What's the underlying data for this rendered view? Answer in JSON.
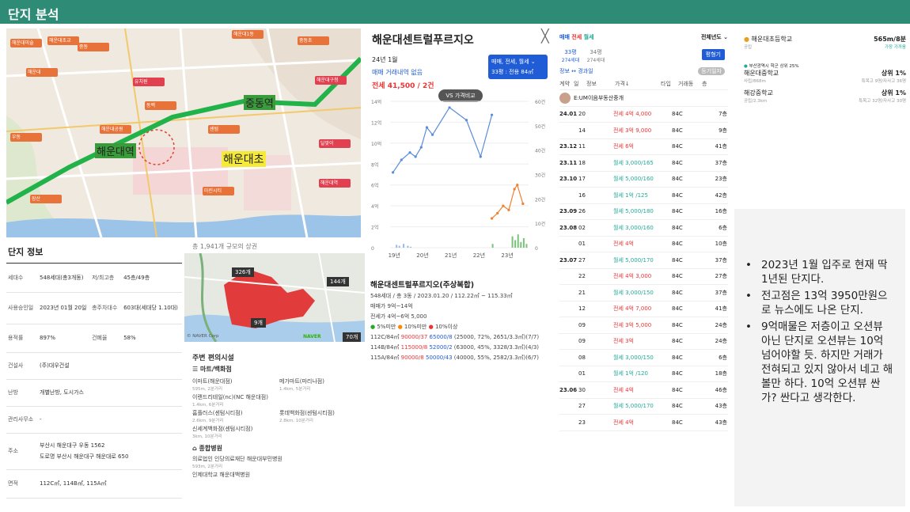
{
  "header": {
    "title": "단지 분석"
  },
  "map1": {
    "station_labels": [
      "중동역",
      "해운대역"
    ],
    "beach_label": "해운대초",
    "poi_labels": [
      "해운대미술",
      "해운대초교",
      "중동",
      "해운대",
      "유치원",
      "해운대1동",
      "중동초",
      "해운대구청",
      "동백",
      "센텀",
      "우동",
      "해운대공원",
      "달맞이",
      "마린시티",
      "장산",
      "해운대역"
    ]
  },
  "info": {
    "title": "단지 정보",
    "rows": [
      {
        "k1": "세대수",
        "v1": "548세대(총3개동)",
        "k2": "저/최고층",
        "v2": "45층/49층"
      },
      {
        "k1": "사용승인일",
        "v1": "2023년 01월 20일",
        "k2": "총주차대수",
        "v2": "603대(세대당 1.10대)"
      },
      {
        "k1": "용적률",
        "v1": "897%",
        "k2": "건폐율",
        "v2": "58%"
      },
      {
        "k1": "건설사",
        "v1": "(주)대우건설",
        "k2": "",
        "v2": ""
      },
      {
        "k1": "난방",
        "v1": "개별난방, 도시가스",
        "k2": "",
        "v2": ""
      },
      {
        "k1": "관리사무소",
        "v1": "-",
        "k2": "",
        "v2": ""
      },
      {
        "k1": "주소",
        "v1": "부산시 해운대구 우동 1562",
        "v1b": "도로명 부산시 해운대구 해운대로 650",
        "k2": "",
        "v2": ""
      },
      {
        "k1": "면적",
        "v1": "112C㎡, 114B㎡, 115A㎡",
        "k2": "",
        "v2": ""
      }
    ]
  },
  "map2": {
    "caption": "총 1,941개 규모의 상권",
    "labels": [
      "326개",
      "144개",
      "70개",
      "9개"
    ],
    "corner": "© NAVER Corp",
    "brand": "NAVER"
  },
  "facilities": {
    "title": "주변 편의시설",
    "mart_title": "마트/백화점",
    "marts": [
      {
        "name": "이마트(해운대점)",
        "dist": "595m, 2분거리"
      },
      {
        "name": "메가마트(마리나점)",
        "dist": "1.4km, 5분거리"
      },
      {
        "name": "이랜드리테일(nc)(NC 해운대점)",
        "dist": "1.4km, 6분거리"
      },
      {
        "name": "홈플러스(센텀시티점)",
        "dist": "2.6km, 9분거리"
      },
      {
        "name": "롯데백화점(센텀시티점)",
        "dist": "2.8km, 10분거리"
      },
      {
        "name": "신세계백화점(센텀시티점)",
        "dist": "3km, 10분거리"
      }
    ],
    "hospital_title": "종합병원",
    "hospitals": [
      {
        "name": "의료법인 인당의료재단 해운대부민병원",
        "dist": "593m, 2분거리"
      },
      {
        "name": "인제대학교 해운대백병원",
        "dist": ""
      }
    ]
  },
  "complex": {
    "name": "해운대센트럴푸르지오",
    "date": "24년 1월",
    "no_trade": "매매 거래내역 없음",
    "price": "전세 41,500 / 2건",
    "selector_line1": "매매, 전세, 월세 ⌄",
    "selector_line2": "33평 : 전용 84㎡",
    "vs_button": "VS 가격비교",
    "close": "╳"
  },
  "chart_data": {
    "type": "line",
    "x_ticks": [
      "19년",
      "20년",
      "21년",
      "22년",
      "23년"
    ],
    "y_left_ticks": [
      "0",
      "2억",
      "4억",
      "6억",
      "8억",
      "10억",
      "12억",
      "14억"
    ],
    "y_right_ticks": [
      "0",
      "10건",
      "20건",
      "30건",
      "40건",
      "50건",
      "60건"
    ],
    "series": [
      {
        "name": "매매",
        "color": "#5b8dd9",
        "points": [
          [
            2019.0,
            7.2
          ],
          [
            2019.3,
            8.4
          ],
          [
            2019.6,
            9.1
          ],
          [
            2019.8,
            8.7
          ],
          [
            2020.0,
            9.6
          ],
          [
            2020.2,
            11.5
          ],
          [
            2020.4,
            10.8
          ],
          [
            2021.0,
            13.4
          ],
          [
            2021.6,
            12.2
          ],
          [
            2022.1,
            8.7
          ],
          [
            2022.5,
            12.7
          ]
        ]
      },
      {
        "name": "전세",
        "color": "#f08030",
        "points": [
          [
            2022.5,
            2.8
          ],
          [
            2022.7,
            3.3
          ],
          [
            2022.9,
            4.0
          ],
          [
            2023.1,
            3.6
          ],
          [
            2023.3,
            5.6
          ],
          [
            2023.4,
            6.0
          ],
          [
            2023.6,
            4.2
          ]
        ]
      }
    ],
    "ylim_left": [
      0,
      14
    ],
    "ylim_right": [
      0,
      60
    ]
  },
  "listing": {
    "title": "해운대센트럴푸르지오(주상복합)",
    "sub": "548세대 / 총 3동 / 2023.01.20 / 112.22㎡ ~ 115.33㎡",
    "sale": "매매가 9억~14억",
    "jeonse": "전세가 4억~6억 5,000",
    "legend": [
      "5%미만",
      "10%미만",
      "10%이상"
    ],
    "lines": [
      {
        "type": "112C/84㎡",
        "a": "90000/37",
        "b": "65000/8",
        "c": "(25000, 72%, 2651/3.3㎡)(7/7)"
      },
      {
        "type": "114B/84㎡",
        "a": "115000/8",
        "b": "52000/2",
        "c": "(63000, 45%, 3328/3.3㎡)(4/3)"
      },
      {
        "type": "115A/84㎡",
        "a": "90000/8",
        "b": "50000/43",
        "c": "(40000, 55%, 2582/3.3㎡)(6/7)"
      }
    ]
  },
  "table": {
    "tabs": [
      "매매",
      "전세",
      "월세"
    ],
    "year_select": "전체년도 ⌄",
    "size_a": "33평",
    "size_a_sub": "274세대",
    "size_b": "34평",
    "size_b_sub": "274세대",
    "size_button": "평형기",
    "info_label": "정보 ↔ 경과일",
    "tag": "등기일자",
    "head": [
      "계약",
      "일",
      "정보",
      "가격↓",
      "타입",
      "거래동",
      "층"
    ],
    "agent": "E:UM이음부동산중개",
    "rows": [
      [
        "24.01",
        "20",
        "전세 4억 4,000",
        "84C",
        "7층"
      ],
      [
        "",
        "14",
        "전세 3억 9,000",
        "84C",
        "9층"
      ],
      [
        "23.12",
        "11",
        "전세 6억",
        "84C",
        "41층"
      ],
      [
        "23.11",
        "18",
        "월세 3,000/165",
        "84C",
        "37층"
      ],
      [
        "23.10",
        "17",
        "월세 5,000/160",
        "84C",
        "23층"
      ],
      [
        "",
        "16",
        "월세 1억 /125",
        "84C",
        "42층"
      ],
      [
        "23.09",
        "26",
        "월세 5,000/180",
        "84C",
        "16층"
      ],
      [
        "23.08",
        "02",
        "월세 3,000/160",
        "84C",
        "6층"
      ],
      [
        "",
        "01",
        "전세 4억",
        "84C",
        "10층"
      ],
      [
        "23.07",
        "27",
        "월세 5,000/170",
        "84C",
        "37층"
      ],
      [
        "",
        "22",
        "전세 4억 3,000",
        "84C",
        "27층"
      ],
      [
        "",
        "21",
        "월세 3,000/150",
        "84C",
        "37층"
      ],
      [
        "",
        "12",
        "전세 4억 7,000",
        "84C",
        "41층"
      ],
      [
        "",
        "09",
        "전세 3억 5,000",
        "84C",
        "24층"
      ],
      [
        "",
        "09",
        "전세 3억",
        "84C",
        "24층"
      ],
      [
        "",
        "08",
        "월세 3,000/150",
        "84C",
        "6층"
      ],
      [
        "",
        "01",
        "월세 1억 /120",
        "84C",
        "18층"
      ],
      [
        "23.06",
        "30",
        "전세 4억",
        "84C",
        "46층"
      ],
      [
        "",
        "27",
        "월세 5,000/170",
        "84C",
        "43층"
      ],
      [
        "",
        "23",
        "전세 4억",
        "84C",
        "43층"
      ]
    ]
  },
  "schools": [
    {
      "name": "해운대초등학교",
      "val": "565m/8분",
      "sub_l": "공립",
      "sub_r": "가장 가까움"
    },
    {
      "name": "해운대중학교",
      "val": "상위 1%",
      "sub_l": "사립/868m",
      "sub_r": "특목고 9명/자사고 36명",
      "pre": "부산광역시 학군 상위 25%"
    },
    {
      "name": "해강중학교",
      "val": "상위 1%",
      "sub_l": "공립/2.3km",
      "sub_r": "특목고 32명/자사고 30명"
    }
  ],
  "note": {
    "items": [
      "2023년 1월 입주로 현재 딱 1년된 단지다.",
      "전고점은 13억 3950만원으로 뉴스에도 나온 단지.",
      "9억매물은 저층이고 오션뷰 아닌 단지로 오션뷰는 10억 넘어야할 듯. 하지만 거래가 전혀되고 있지 않아서 네고 해볼만 하다. 10억 오션뷰 싼가? 싼다고 생각한다."
    ]
  }
}
